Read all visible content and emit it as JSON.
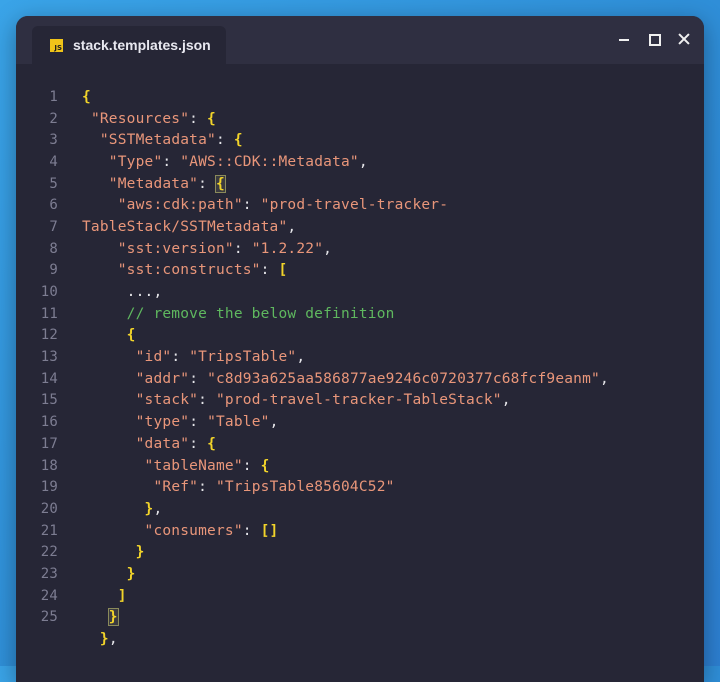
{
  "window": {
    "tab_title": "stack.templates.json",
    "file_icon": "js-file-icon",
    "controls": [
      "minimize",
      "maximize",
      "close"
    ]
  },
  "editor": {
    "lines": [
      {
        "n": "1",
        "indent": "",
        "segments": [
          {
            "t": "b",
            "v": "{"
          }
        ]
      },
      {
        "n": "2",
        "indent": " ",
        "segments": [
          {
            "t": "k",
            "v": "\"Resources\""
          },
          {
            "t": "p",
            "v": ": "
          },
          {
            "t": "b",
            "v": "{"
          }
        ]
      },
      {
        "n": "3",
        "indent": "  ",
        "segments": [
          {
            "t": "k",
            "v": "\"SSTMetadata\""
          },
          {
            "t": "p",
            "v": ": "
          },
          {
            "t": "b",
            "v": "{"
          }
        ]
      },
      {
        "n": "4",
        "indent": "   ",
        "segments": [
          {
            "t": "k",
            "v": "\"Type\""
          },
          {
            "t": "p",
            "v": ": "
          },
          {
            "t": "k",
            "v": "\"AWS::CDK::Metadata\""
          },
          {
            "t": "p",
            "v": ","
          }
        ]
      },
      {
        "n": "5",
        "indent": "   ",
        "segments": [
          {
            "t": "k",
            "v": "\"Metadata\""
          },
          {
            "t": "p",
            "v": ": "
          },
          {
            "t": "b hl",
            "v": "{"
          }
        ]
      },
      {
        "n": "6",
        "indent": "    ",
        "segments": [
          {
            "t": "k",
            "v": "\"aws:cdk:path\""
          },
          {
            "t": "p",
            "v": ": "
          },
          {
            "t": "k",
            "v": "\"prod-travel-tracker-"
          }
        ]
      },
      {
        "n": "7",
        "indent": "",
        "segments": [
          {
            "t": "k",
            "v": "TableStack/SSTMetadata\""
          },
          {
            "t": "p",
            "v": ","
          }
        ]
      },
      {
        "n": "8",
        "indent": "    ",
        "segments": [
          {
            "t": "k",
            "v": "\"sst:version\""
          },
          {
            "t": "p",
            "v": ": "
          },
          {
            "t": "k",
            "v": "\"1.2.22\""
          },
          {
            "t": "p",
            "v": ","
          }
        ]
      },
      {
        "n": "9",
        "indent": "    ",
        "segments": [
          {
            "t": "k",
            "v": "\"sst:constructs\""
          },
          {
            "t": "p",
            "v": ": "
          },
          {
            "t": "b",
            "v": "["
          }
        ]
      },
      {
        "n": "10",
        "indent": "     ",
        "segments": [
          {
            "t": "p",
            "v": "...,"
          }
        ]
      },
      {
        "n": "11",
        "indent": "     ",
        "segments": [
          {
            "t": "c",
            "v": "// remove the below definition"
          }
        ]
      },
      {
        "n": "12",
        "indent": "     ",
        "segments": [
          {
            "t": "b",
            "v": "{"
          }
        ]
      },
      {
        "n": "13",
        "indent": "      ",
        "segments": [
          {
            "t": "k",
            "v": "\"id\""
          },
          {
            "t": "p",
            "v": ": "
          },
          {
            "t": "k",
            "v": "\"TripsTable\""
          },
          {
            "t": "p",
            "v": ","
          }
        ]
      },
      {
        "n": "14",
        "indent": "      ",
        "segments": [
          {
            "t": "k",
            "v": "\"addr\""
          },
          {
            "t": "p",
            "v": ": "
          },
          {
            "t": "k",
            "v": "\"c8d93a625aa586877ae9246c0720377c68fcf9eanm\""
          },
          {
            "t": "p",
            "v": ","
          }
        ]
      },
      {
        "n": "15",
        "indent": "      ",
        "segments": [
          {
            "t": "k",
            "v": "\"stack\""
          },
          {
            "t": "p",
            "v": ": "
          },
          {
            "t": "k",
            "v": "\"prod-travel-tracker-TableStack\""
          },
          {
            "t": "p",
            "v": ","
          }
        ]
      },
      {
        "n": "16",
        "indent": "      ",
        "segments": [
          {
            "t": "k",
            "v": "\"type\""
          },
          {
            "t": "p",
            "v": ": "
          },
          {
            "t": "k",
            "v": "\"Table\""
          },
          {
            "t": "p",
            "v": ","
          }
        ]
      },
      {
        "n": "17",
        "indent": "      ",
        "segments": [
          {
            "t": "k",
            "v": "\"data\""
          },
          {
            "t": "p",
            "v": ": "
          },
          {
            "t": "b",
            "v": "{"
          }
        ]
      },
      {
        "n": "18",
        "indent": "       ",
        "segments": [
          {
            "t": "k",
            "v": "\"tableName\""
          },
          {
            "t": "p",
            "v": ": "
          },
          {
            "t": "b",
            "v": "{"
          }
        ]
      },
      {
        "n": "19",
        "indent": "        ",
        "segments": [
          {
            "t": "k",
            "v": "\"Ref\""
          },
          {
            "t": "p",
            "v": ": "
          },
          {
            "t": "k",
            "v": "\"TripsTable85604C52\""
          }
        ]
      },
      {
        "n": "20",
        "indent": "       ",
        "segments": [
          {
            "t": "b",
            "v": "}"
          },
          {
            "t": "p",
            "v": ","
          }
        ]
      },
      {
        "n": "21",
        "indent": "       ",
        "segments": [
          {
            "t": "k",
            "v": "\"consumers\""
          },
          {
            "t": "p",
            "v": ": "
          },
          {
            "t": "b",
            "v": "[]"
          }
        ]
      },
      {
        "n": "22",
        "indent": "      ",
        "segments": [
          {
            "t": "b",
            "v": "}"
          }
        ]
      },
      {
        "n": "23",
        "indent": "     ",
        "segments": [
          {
            "t": "b",
            "v": "}"
          }
        ]
      },
      {
        "n": "24",
        "indent": "    ",
        "segments": [
          {
            "t": "b",
            "v": "]"
          }
        ]
      },
      {
        "n": "25",
        "indent": "   ",
        "segments": [
          {
            "t": "b hl",
            "v": "}"
          }
        ]
      },
      {
        "n": "",
        "indent": "  ",
        "segments": [
          {
            "t": "b",
            "v": "}"
          },
          {
            "t": "p",
            "v": ","
          }
        ]
      }
    ]
  }
}
